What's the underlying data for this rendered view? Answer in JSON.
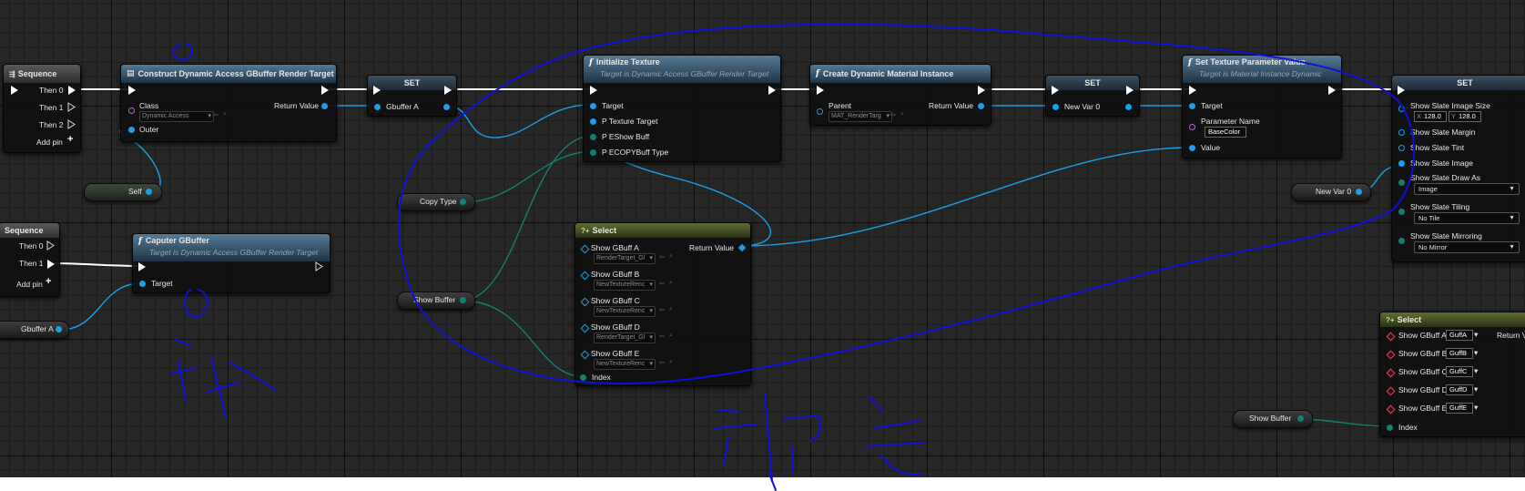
{
  "nodes": {
    "sequence1": {
      "title": "Sequence",
      "then0": "Then 0",
      "then1": "Then 1",
      "then2": "Then 2",
      "add_pin": "Add pin"
    },
    "construct": {
      "title": "Construct Dynamic Access GBuffer Render Target",
      "class_label": "Class",
      "class_value": "Dynamic Access",
      "return_value": "Return Value",
      "outer": "Outer"
    },
    "set1": {
      "title": "SET",
      "pin": "Gbuffer A"
    },
    "init_texture": {
      "title": "Initialize Texture",
      "subtitle": "Target is Dynamic Access GBuffer Render Target",
      "target": "Target",
      "p_texture_target": "P Texture Target",
      "p_eshow_buff": "P EShow Buff",
      "p_ecopybuff_type": "P ECOPYBuff Type"
    },
    "create_dmi": {
      "title": "Create Dynamic Material Instance",
      "parent": "Parent",
      "parent_value": "MAT_RenderTarg",
      "return_value": "Return Value"
    },
    "set2": {
      "title": "SET",
      "pin": "New Var 0"
    },
    "set_tex_param": {
      "title": "Set Texture Parameter Value",
      "subtitle": "Target is Material Instance Dynamic",
      "target": "Target",
      "param_name": "Parameter Name",
      "param_value": "BaseColor",
      "value": "Value"
    },
    "set3": {
      "title": "SET",
      "image_size": "Show Slate Image Size",
      "x_axis": "X",
      "x_value": "128.0",
      "y_axis": "Y",
      "y_value": "128.0",
      "margin": "Show Slate Margin",
      "tint": "Show Slate Tint",
      "image": "Show Slate Image",
      "draw_as": "Show Slate Draw As",
      "draw_as_value": "Image",
      "tiling": "Show Slate Tiling",
      "tiling_value": "No Tile",
      "mirroring": "Show Slate Mirroring",
      "mirroring_value": "No Mirror"
    },
    "self_var": {
      "label": "Self"
    },
    "copy_type_var": {
      "label": "Copy Type"
    },
    "show_buffer_var": {
      "label": "Show Buffer"
    },
    "new_var0": {
      "label": "New Var 0"
    },
    "sequence2": {
      "title": "Sequence",
      "then0": "Then 0",
      "then1": "Then 1",
      "add_pin": "Add pin"
    },
    "capture": {
      "title": "Caputer GBuffer",
      "subtitle": "Target is Dynamic Access GBuffer Render Target",
      "target": "Target"
    },
    "gbuffer_var": {
      "label": "Gbuffer A"
    },
    "select1": {
      "title": "Select",
      "options": [
        {
          "label": "Show GBuff A",
          "value": "RenderTarget_Gl"
        },
        {
          "label": "Show GBuff B",
          "value": "NewTextureRenc"
        },
        {
          "label": "Show GBuff C",
          "value": "NewTextureRenc"
        },
        {
          "label": "Show GBuff D",
          "value": "RenderTarget_Gl"
        },
        {
          "label": "Show GBuff E",
          "value": "NewTextureRenc"
        }
      ],
      "return_value": "Return Value",
      "index": "Index"
    },
    "select2": {
      "title": "Select",
      "options": [
        {
          "label": "Show GBuff A",
          "value": "GuffA"
        },
        {
          "label": "Show GBuff B",
          "value": "GuffB"
        },
        {
          "label": "Show GBuff C",
          "value": "GuffC"
        },
        {
          "label": "Show GBuff D",
          "value": "GuffD"
        },
        {
          "label": "Show GBuff E",
          "value": "GuffE"
        }
      ],
      "return_value": "Return V",
      "index": "Index"
    },
    "show_buffer_var2": {
      "label": "Show Buffer"
    }
  },
  "colors": {
    "canvas": "#262626",
    "exec_wire": "#ffffff",
    "object_wire": "#1aa0e6",
    "enum_wire": "#13806f",
    "annotation_ink": "#1010d8",
    "function_header": "#3f607a",
    "select_header": "#4b5a24"
  },
  "icons": [
    "function-icon",
    "sequence-icon",
    "class-icon",
    "select-icon",
    "add-pin-icon",
    "browse-icon",
    "use-selected-icon",
    "dropdown-icon"
  ]
}
